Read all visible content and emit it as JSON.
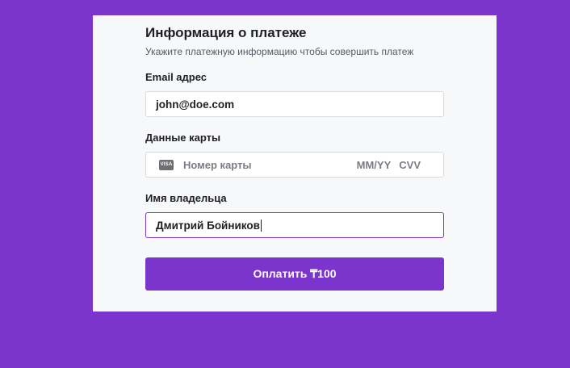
{
  "header": {
    "title": "Информация о платеже",
    "subtitle": "Укажите платежную информацию чтобы совершить платеж"
  },
  "email": {
    "label": "Email адрес",
    "value": "john@doe.com"
  },
  "card": {
    "label": "Данные карты",
    "brand_icon": "VISA",
    "number_placeholder": "Номер карты",
    "expiry_placeholder": "MM/YY",
    "cvv_placeholder": "CVV"
  },
  "holder": {
    "label": "Имя владельца",
    "value": "Дмитрий Бойников"
  },
  "pay_button": {
    "label": "Оплатить ₸100"
  },
  "colors": {
    "background": "#7b35cc",
    "panel": "#f7f8fa",
    "accent": "#7b35cc"
  }
}
